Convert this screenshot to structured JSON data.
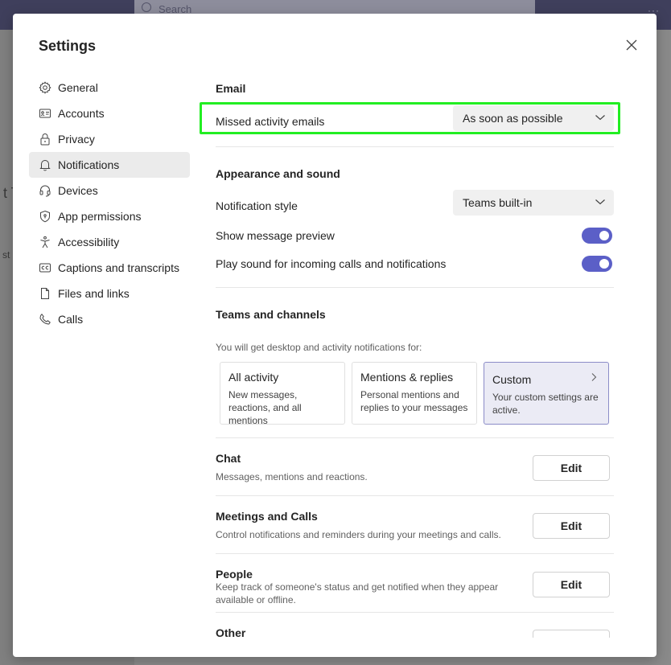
{
  "background": {
    "search_placeholder": "Search",
    "left_fragment_1": "t T",
    "left_fragment_2": "st"
  },
  "dialog": {
    "title": "Settings"
  },
  "nav": {
    "items": [
      {
        "label": "General",
        "icon": "gear-icon"
      },
      {
        "label": "Accounts",
        "icon": "id-card-icon"
      },
      {
        "label": "Privacy",
        "icon": "lock-icon"
      },
      {
        "label": "Notifications",
        "icon": "bell-icon",
        "active": true
      },
      {
        "label": "Devices",
        "icon": "headset-icon"
      },
      {
        "label": "App permissions",
        "icon": "shield-icon"
      },
      {
        "label": "Accessibility",
        "icon": "accessibility-icon"
      },
      {
        "label": "Captions and transcripts",
        "icon": "cc-icon"
      },
      {
        "label": "Files and links",
        "icon": "file-icon"
      },
      {
        "label": "Calls",
        "icon": "phone-icon"
      }
    ]
  },
  "email": {
    "title": "Email",
    "missed_label": "Missed activity emails",
    "missed_value": "As soon as possible"
  },
  "appearance": {
    "title": "Appearance and sound",
    "style_label": "Notification style",
    "style_value": "Teams built-in",
    "preview_label": "Show message preview",
    "preview_on": true,
    "sound_label": "Play sound for incoming calls and notifications",
    "sound_on": true
  },
  "teams": {
    "title": "Teams and channels",
    "subtitle": "You will get desktop and activity notifications for:",
    "cards": [
      {
        "title": "All activity",
        "desc": "New messages, reactions, and all mentions"
      },
      {
        "title": "Mentions & replies",
        "desc": "Personal mentions and replies to your messages"
      },
      {
        "title": "Custom",
        "desc": "Your custom settings are active.",
        "selected": true
      }
    ]
  },
  "chat": {
    "title": "Chat",
    "desc": "Messages, mentions and reactions.",
    "button": "Edit"
  },
  "meetings": {
    "title": "Meetings and Calls",
    "desc": "Control notifications and reminders during your meetings and calls.",
    "button": "Edit"
  },
  "people": {
    "title": "People",
    "desc": "Keep track of someone's status and get notified when they appear available or offline.",
    "button": "Edit"
  },
  "other": {
    "title": "Other"
  },
  "colors": {
    "accent": "#5b5fc7",
    "highlight": "#22ee22"
  }
}
